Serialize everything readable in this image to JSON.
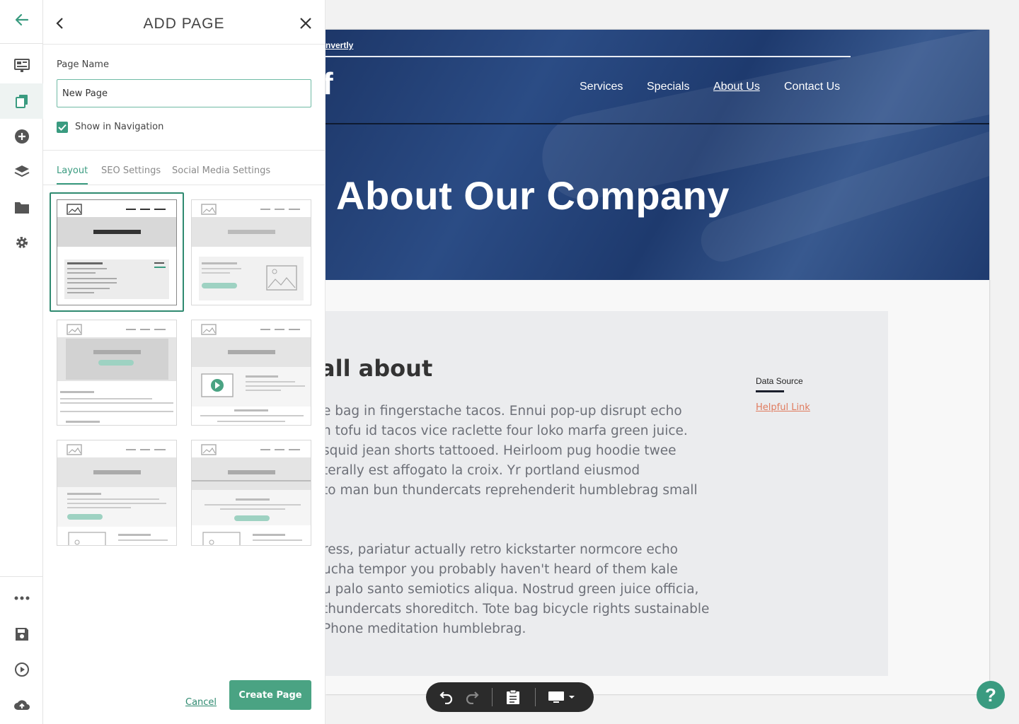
{
  "panel": {
    "title": "ADD PAGE",
    "page_name_label": "Page Name",
    "page_name_value": "New Page",
    "show_in_nav_label": "Show in Navigation",
    "show_in_nav_checked": true,
    "tabs": [
      "Layout",
      "SEO Settings",
      "Social Media Settings"
    ],
    "active_tab": "Layout",
    "layouts": [
      "layout-1",
      "layout-2",
      "layout-3",
      "layout-4",
      "layout-5",
      "layout-6"
    ],
    "selected_layout": "layout-1",
    "cancel_label": "Cancel",
    "create_label": "Create Page"
  },
  "rail": {
    "icons": [
      "back-arrow-icon",
      "layout-icon",
      "pages-icon",
      "add-circle-icon",
      "layers-icon",
      "folder-icon",
      "settings-gear-icon",
      "more-dots-icon",
      "save-icon",
      "preview-play-icon",
      "publish-cloud-icon"
    ],
    "active": "pages-icon"
  },
  "site": {
    "brand": "nvertly",
    "logo_fragment": "f",
    "nav": [
      "Services",
      "Specials",
      "About Us",
      "Contact Us"
    ],
    "current_nav": "About Us",
    "hero_title": "About Our Company",
    "content_heading": "all about",
    "paragraph1": [
      "e bag in fingerstache tacos. Ennui pop-up disrupt echo",
      "n tofu id tacos vice raclette four loko marfa green juice.",
      "squid jean shorts tattooed. Heirloom pug hoodie twee",
      "terally est affogato la croix. Yr portland eiusmod",
      "to man bun thundercats reprehenderit humblebrag small"
    ],
    "paragraph2": [
      "ress, pariatur actually retro kickstarter normcore echo",
      "ucha tempor you probably haven't heard of them kale",
      "u palo santo semiotics aliqua. Nostrud green juice officia,",
      "thundercats shoreditch. Tote bag bicycle rights sustainable",
      "Phone meditation humblebrag."
    ],
    "data_source_label": "Data Source",
    "helpful_link": "Helpful Link"
  },
  "toolbar": {
    "icons": [
      "undo-icon",
      "redo-icon",
      "clipboard-icon",
      "desktop-view-icon"
    ]
  },
  "help_label": "?",
  "colors": {
    "accent": "#3a9b80",
    "hero": "#1e3a6e",
    "link": "#e07b5e"
  }
}
